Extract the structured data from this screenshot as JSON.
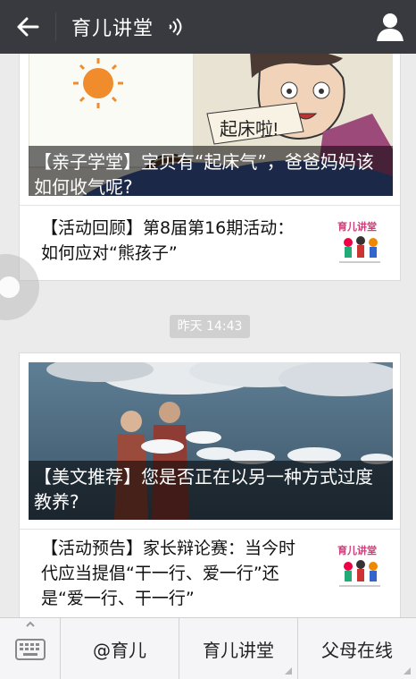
{
  "header": {
    "title": "育儿讲堂",
    "back_icon": "arrow-left-icon",
    "voice_icon": "voice-wave-icon",
    "profile_icon": "person-icon"
  },
  "feed": {
    "card1": {
      "cover_caption": "【亲子学堂】宝贝有“起床气”，爸爸妈妈该如何收气呢?",
      "cover_text_sign": "起床啦!",
      "item_title": "【活动回顾】第8届第16期活动：如何应对“熊孩子”"
    },
    "timestamp": "昨天 14:43",
    "card2": {
      "cover_caption": "【美文推荐】您是否正在以另一种方式过度教养?",
      "item_title": "【活动预告】家长辩论赛：当今时代应当提倡“干一行、爱一行”还是“爱一行、干一行”"
    },
    "thumb_logo_text": "育儿讲堂"
  },
  "bottom_menu": {
    "keyboard_icon": "keyboard-icon",
    "items": [
      "@育儿",
      "育儿讲堂",
      "父母在线"
    ]
  },
  "colors": {
    "topbar": "#393a3f",
    "background": "#ebebeb"
  }
}
